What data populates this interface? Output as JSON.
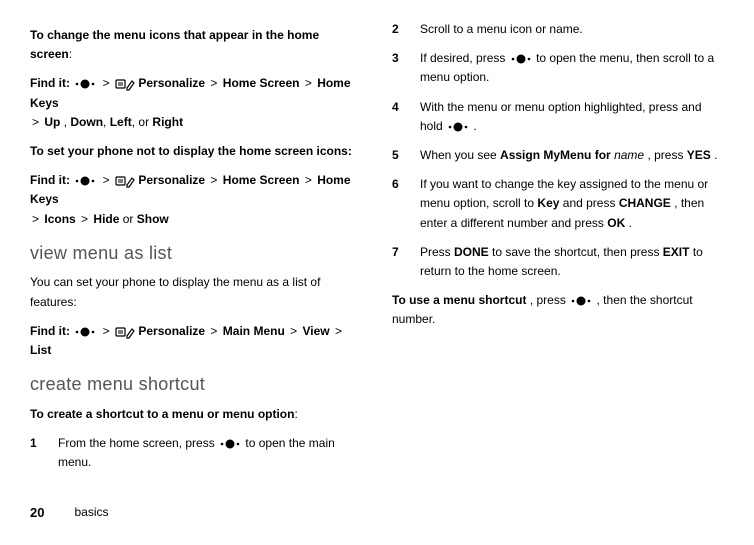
{
  "left": {
    "intro1": "To change the menu icons that appear in the home screen",
    "colon": ":",
    "findit": "Find it:",
    "gt": ">",
    "personalize": "Personalize",
    "homescreen": "Home Screen",
    "homekeys": "Home Keys",
    "up": "Up",
    "comma": " , ",
    "down": "Down",
    "left_lbl": "Left",
    "or": " or ",
    "right": "Right",
    "intro2": "To set your phone not to display the home screen icons:",
    "icons": "Icons",
    "hide": "Hide",
    "show": "Show",
    "section_view": "view menu as list",
    "view_text": "You can set your phone to display the menu as a list of features:",
    "mainmenu": "Main Menu",
    "view": "View",
    "list": "List",
    "section_shortcut": "create menu shortcut",
    "create_bold": "To create a shortcut to a menu or menu option",
    "step1_num": "1",
    "step1_a": "From the home screen, press ",
    "step1_b": " to open the main menu."
  },
  "right": {
    "step2_num": "2",
    "step2": "Scroll to a menu icon or name.",
    "step3_num": "3",
    "step3_a": "If desired, press ",
    "step3_b": " to open the menu, then scroll to a menu option.",
    "step4_num": "4",
    "step4_a": "With the menu or menu option highlighted, press and hold ",
    "step4_b": ".",
    "step5_num": "5",
    "step5_a": "When you see ",
    "step5_assign": "Assign MyMenu for",
    "step5_name": " name",
    "step5_b": ", press ",
    "step5_yes": "YES",
    "step5_c": ".",
    "step6_num": "6",
    "step6_a": "If you want to change the key assigned to the menu or menu option, scroll to ",
    "step6_key": "Key",
    "step6_b": " and press ",
    "step6_change": "CHANGE",
    "step6_c": ", then enter a different number and press ",
    "step6_ok": "OK",
    "step6_d": ".",
    "step7_num": "7",
    "step7_a": "Press ",
    "step7_done": "DONE",
    "step7_b": " to save the shortcut, then press ",
    "step7_exit": "EXIT",
    "step7_c": " to return to the home screen.",
    "touse_bold": "To use a menu shortcut",
    "touse_a": ", press ",
    "touse_b": ", then the shortcut number."
  },
  "footer": {
    "page": "20",
    "label": "basics"
  }
}
